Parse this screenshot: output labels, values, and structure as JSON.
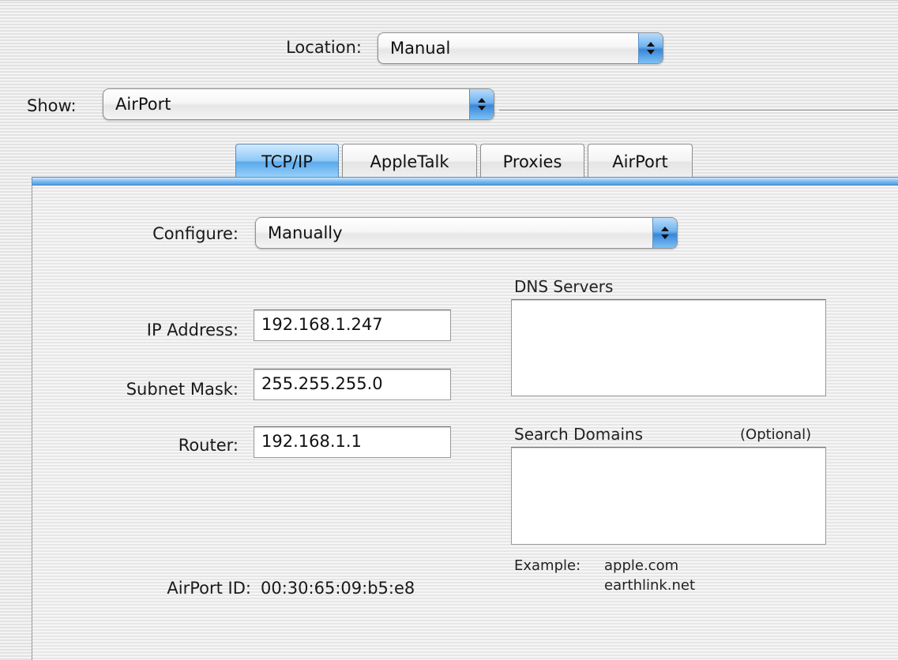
{
  "location": {
    "label": "Location:",
    "value": "Manual"
  },
  "show": {
    "label": "Show:",
    "value": "AirPort"
  },
  "tabs": [
    {
      "label": "TCP/IP",
      "active": true
    },
    {
      "label": "AppleTalk",
      "active": false
    },
    {
      "label": "Proxies",
      "active": false
    },
    {
      "label": "AirPort",
      "active": false
    }
  ],
  "configure": {
    "label": "Configure:",
    "value": "Manually"
  },
  "fields": {
    "ip_address": {
      "label": "IP Address:",
      "value": "192.168.1.247"
    },
    "subnet_mask": {
      "label": "Subnet Mask:",
      "value": "255.255.255.0"
    },
    "router": {
      "label": "Router:",
      "value": "192.168.1.1"
    }
  },
  "dns": {
    "label": "DNS Servers",
    "value": ""
  },
  "search_domains": {
    "label": "Search Domains",
    "optional": "(Optional)",
    "value": ""
  },
  "example": {
    "label": "Example:",
    "line1": "apple.com",
    "line2": "earthlink.net"
  },
  "airport_id": {
    "label": "AirPort ID:",
    "value": "00:30:65:09:b5:e8"
  },
  "colors": {
    "accent": "#5aa9ec",
    "popup_arrow": "#3a86d8"
  },
  "icons": {
    "popup": "up-down-arrows-icon"
  }
}
